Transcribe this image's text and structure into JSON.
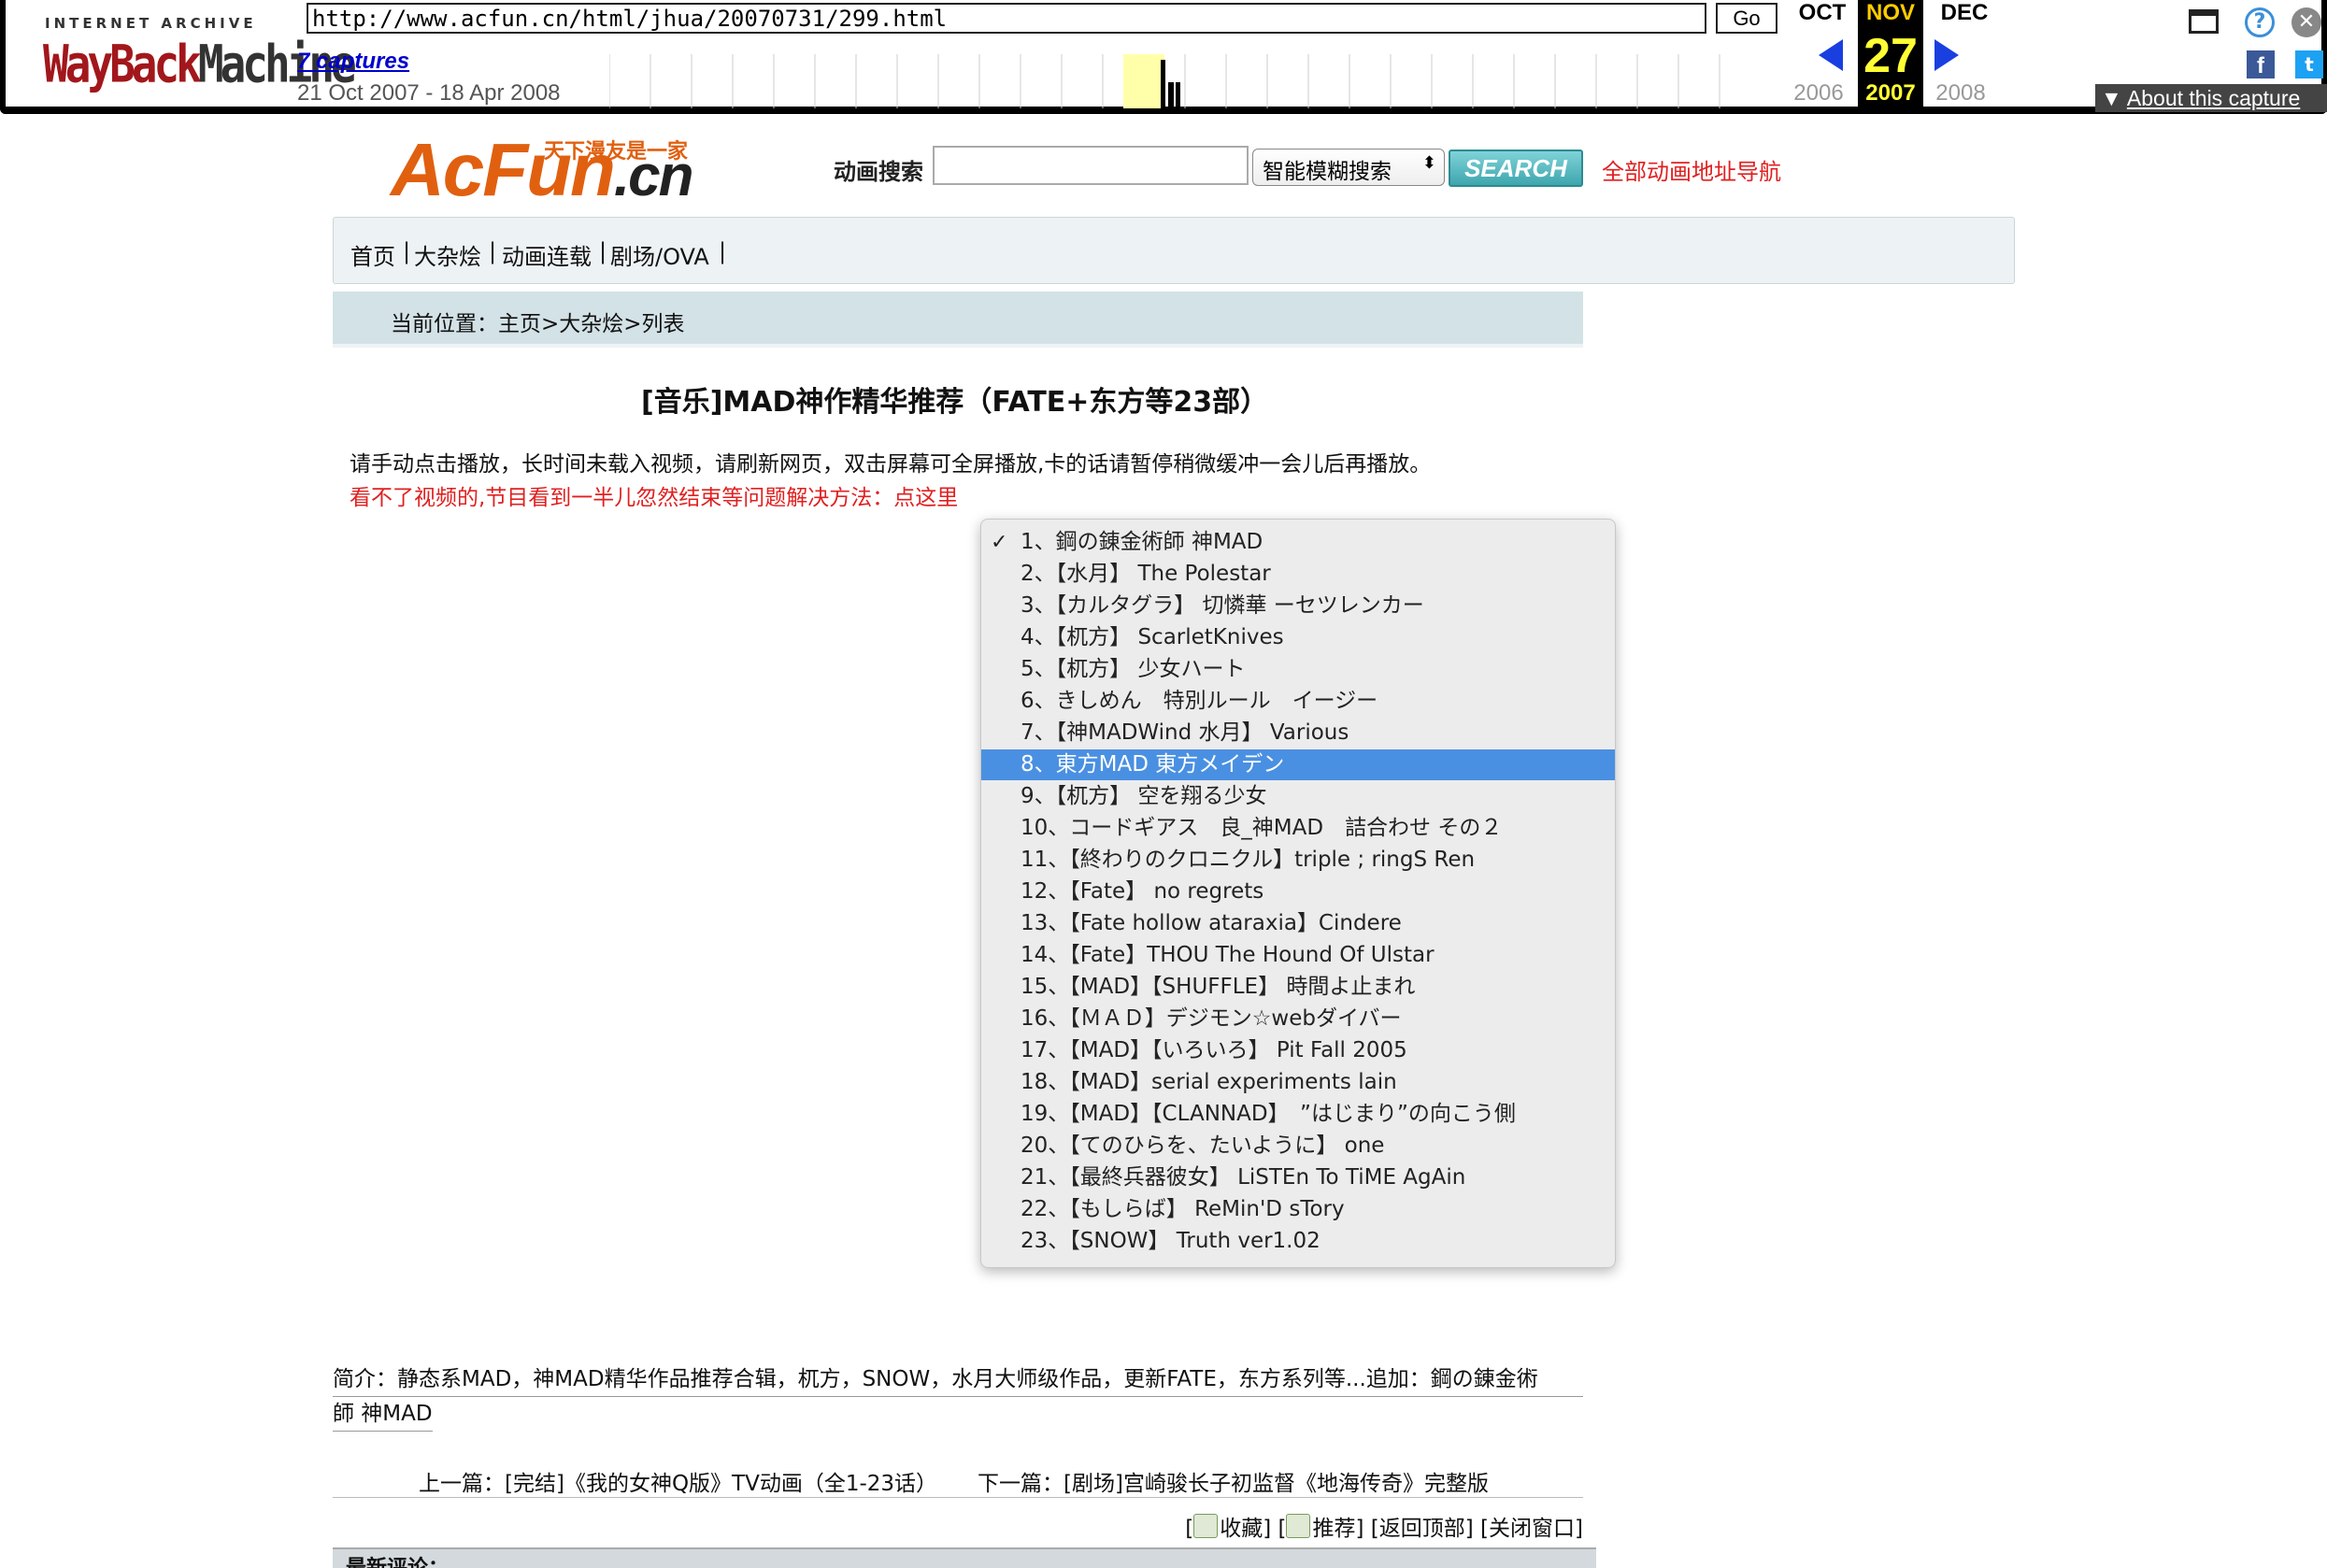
{
  "wayback": {
    "logo_top": "INTERNET ARCHIVE",
    "logo_wayback": "WayBack",
    "logo_machine": "Machine",
    "url": "http://www.acfun.cn/html/jhua/20070731/299.html",
    "go_label": "Go",
    "captures_link": "7 captures",
    "date_range": "21 Oct 2007 - 18 Apr 2008",
    "months": {
      "prev": "OCT",
      "current": "NOV",
      "next": "DEC"
    },
    "day": "27",
    "years": {
      "prev": "2006",
      "current": "2007",
      "next": "2008"
    },
    "about_label": "About this capture",
    "icons": [
      "window-icon",
      "help-icon",
      "close-icon",
      "facebook-icon",
      "twitter-icon"
    ]
  },
  "site": {
    "logo_text": "AcFun",
    "logo_domain": ".cn",
    "logo_slogan": "天下漫友是一家",
    "search_label": "动画搜索",
    "search_placeholder": "",
    "search_mode": "智能模糊搜索",
    "search_button": "SEARCH",
    "nav_all": "全部动画地址导航"
  },
  "menu": {
    "items": [
      "首页",
      "|",
      "大杂烩",
      "|",
      "动画连载",
      "|",
      "剧场/OVA",
      "|"
    ]
  },
  "breadcrumb": "当前位置：主页>大杂烩>列表",
  "article": {
    "title": "[音乐]MAD神作精华推荐（FATE+东方等23部）",
    "instructions": "请手动点击播放，长时间未载入视频，请刷新网页，双击屏幕可全屏播放,卡的话请暂停稍微缓冲一会儿后再播放。",
    "warning": "看不了视频的,节目看到一半儿忽然结束等问题解决方法：点这里"
  },
  "dropdown": {
    "checked_index": 0,
    "highlighted_index": 7,
    "options": [
      "1、鋼の錬金術師 神MAD",
      "2、【水月】 The Polestar",
      "3、【カルタグラ】 切憐華 ーセツレンカー",
      "4、【杌方】 ScarletKnives",
      "5、【杌方】 少女ハート",
      "6、きしめん　特別ルール　イージー",
      "7、【神MADWind 水月】 Various",
      "8、東方MAD 東方メイデン",
      "9、【杌方】 空を翔る少女",
      "10、コードギアス　良_神MAD　詰合わせ その２",
      "11、【終わりのクロニクル】triple ; ringS Ren",
      "12、【Fate】 no regrets",
      "13、【Fate hollow ataraxia】Cindere",
      "14、【Fate】THOU The Hound Of Ulstar",
      "15、【MAD】【SHUFFLE】 時間よ止まれ",
      "16、【ＭＡＤ】デジモン☆webダイバー",
      "17、【MAD】【いろいろ】 Pit Fall 2005",
      "18、【MAD】serial experiments lain",
      "19、【MAD】【CLANNAD】　”はじまり”の向こう側",
      "20、【てのひらを、たいように】 one",
      "21、【最終兵器彼女】 LiSTEn To TiME AgAin",
      "22、【もしらば】 ReMin'D sTory",
      "23、【SNOW】 Truth ver1.02"
    ]
  },
  "intro": {
    "line1": "简介：静态系MAD，神MAD精华作品推荐合辑，杌方，SNOW，水月大师级作品，更新FATE，东方系列等...追加：鋼の錬金術",
    "line2": "師 神MAD"
  },
  "prev_link": "上一篇：[完结]《我的女神Q版》TV动画（全1-23话）",
  "next_link": "下一篇：[剧场]宫崎骏长子初监督《地海传奇》完整版",
  "tools": {
    "favorite": "收藏",
    "recommend": "推荐",
    "back_to_top": "[返回顶部]",
    "close_window": "[关闭窗口]"
  },
  "comments_label": "最新评论："
}
